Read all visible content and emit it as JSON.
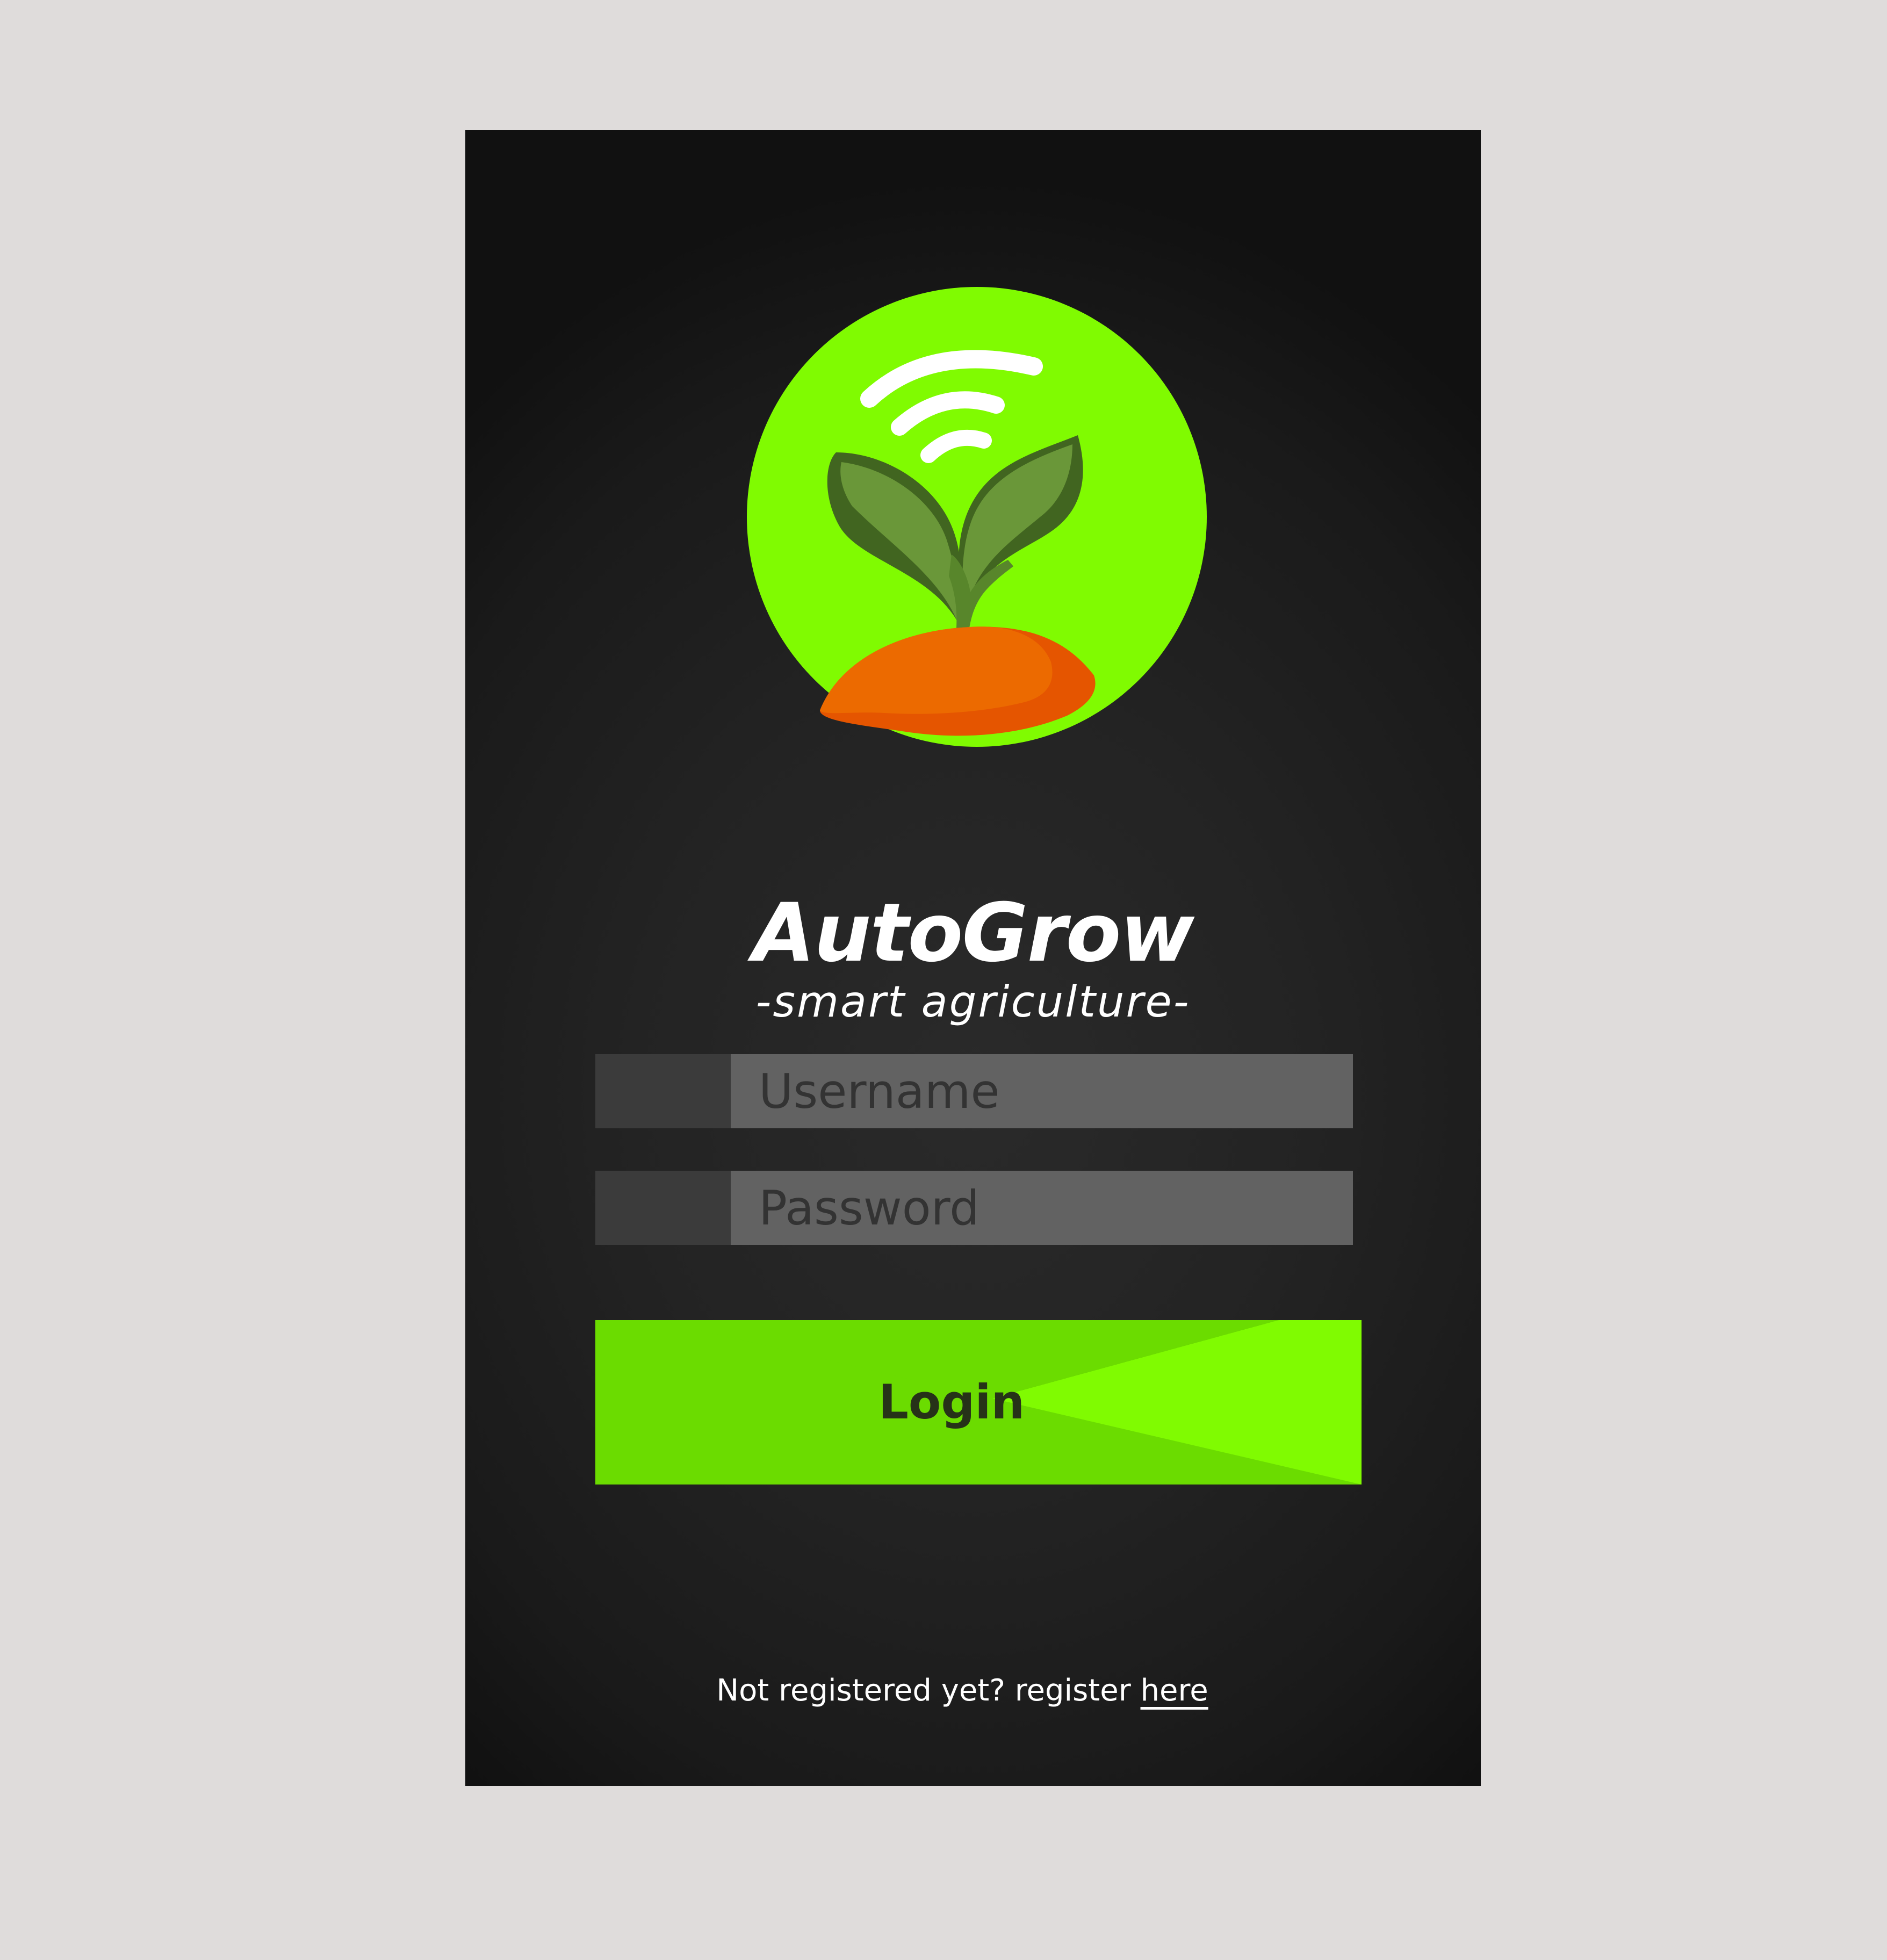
{
  "app": {
    "name": "AutoGrow",
    "tagline": "-smart agriculture-",
    "logo_icon": "sprout-with-wifi-signal-icon"
  },
  "form": {
    "username_placeholder": "Username",
    "password_placeholder": "Password",
    "login_label": "Login"
  },
  "register": {
    "prompt": "Not registered yet? register ",
    "link_label": "here"
  },
  "colors": {
    "page_background": "#dfdcdb",
    "screen_background": "#222222",
    "accent_green": "#80fb01",
    "accent_green_dark": "#6bdc00",
    "soil_orange": "#ec6a00",
    "leaf_green": "#6a9739",
    "input_background": "#626262",
    "input_prefix": "#3b3b3b"
  }
}
